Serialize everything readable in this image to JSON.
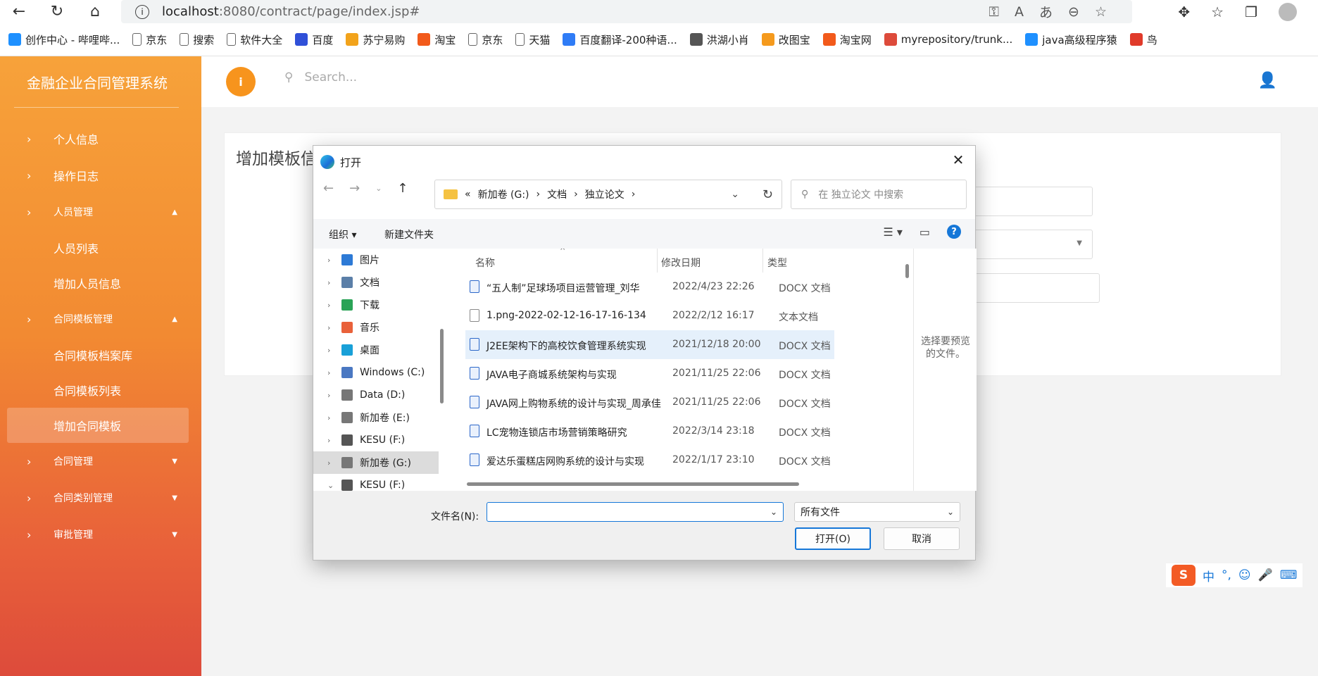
{
  "browser": {
    "url_host": "localhost",
    "url_rest": ":8080/contract/page/index.jsp#",
    "bookmarks": [
      {
        "label": "创作中心 - 哔哩哔...",
        "icon": "bilibili-icon",
        "color": "#1e90ff"
      },
      {
        "label": "京东",
        "icon": "page-icon",
        "color": "#666666"
      },
      {
        "label": "搜索",
        "icon": "page-icon",
        "color": "#666666"
      },
      {
        "label": "软件大全",
        "icon": "page-icon",
        "color": "#666666"
      },
      {
        "label": "百度",
        "icon": "baidu-icon",
        "color": "#3050d8"
      },
      {
        "label": "苏宁易购",
        "icon": "suning-icon",
        "color": "#f2a31b"
      },
      {
        "label": "淘宝",
        "icon": "taobao-icon",
        "color": "#f25a1b"
      },
      {
        "label": "京东",
        "icon": "page-icon",
        "color": "#666666"
      },
      {
        "label": "天猫",
        "icon": "page-icon",
        "color": "#666666"
      },
      {
        "label": "百度翻译-200种语...",
        "icon": "translate-icon",
        "color": "#2f7cf6"
      },
      {
        "label": "洪湖小肖",
        "icon": "bird-icon",
        "color": "#555555"
      },
      {
        "label": "改图宝",
        "icon": "gaitubao-icon",
        "color": "#f59a1d"
      },
      {
        "label": "淘宝网",
        "icon": "taobao-icon",
        "color": "#f25a1b"
      },
      {
        "label": "myrepository/trunk...",
        "icon": "chrome-icon",
        "color": "#dd4b3b"
      },
      {
        "label": "java高级程序猿",
        "icon": "bilibili-icon",
        "color": "#1e90ff"
      },
      {
        "label": "鸟",
        "icon": "bird-red-icon",
        "color": "#e03a2a"
      }
    ]
  },
  "app": {
    "brand": "金融企业合同管理系统",
    "search_placeholder": "Search...",
    "menu": [
      {
        "label": "个人信息",
        "type": "item"
      },
      {
        "label": "操作日志",
        "type": "item"
      },
      {
        "label": "人员管理",
        "type": "group",
        "caret": "▲"
      },
      {
        "label": "人员列表",
        "type": "sub"
      },
      {
        "label": "增加人员信息",
        "type": "sub"
      },
      {
        "label": "合同模板管理",
        "type": "group",
        "caret": "▲"
      },
      {
        "label": "合同模板档案库",
        "type": "sub"
      },
      {
        "label": "合同模板列表",
        "type": "sub"
      },
      {
        "label": "增加合同模板",
        "type": "sub-active"
      },
      {
        "label": "合同管理",
        "type": "group",
        "caret": "▼"
      },
      {
        "label": "合同类别管理",
        "type": "group",
        "caret": "▼"
      },
      {
        "label": "审批管理",
        "type": "group",
        "caret": "▼"
      }
    ],
    "page_title": "增加模板信"
  },
  "dialog": {
    "title": "打开",
    "path": [
      "«",
      "新加卷 (G:)",
      "文档",
      "独立论文"
    ],
    "search_placeholder": "在 独立论文 中搜索",
    "toolbar": {
      "organize": "组织 ▾",
      "new_folder": "新建文件夹"
    },
    "tree": [
      {
        "label": "图片",
        "color": "#2d7ad6"
      },
      {
        "label": "文档",
        "color": "#5b7fa8"
      },
      {
        "label": "下载",
        "color": "#2aa356"
      },
      {
        "label": "音乐",
        "color": "#e9613a"
      },
      {
        "label": "桌面",
        "color": "#19a0d8"
      },
      {
        "label": "Windows (C:)",
        "color": "#4a78c2"
      },
      {
        "label": "Data (D:)",
        "color": "#777777"
      },
      {
        "label": "新加卷 (E:)",
        "color": "#777777"
      },
      {
        "label": "KESU  (F:)",
        "color": "#555555"
      },
      {
        "label": "新加卷 (G:)",
        "color": "#777777",
        "selected": true
      },
      {
        "label": "KESU  (F:)",
        "color": "#555555",
        "expanded": true
      }
    ],
    "columns": {
      "name": "名称",
      "date": "修改日期",
      "type": "类型"
    },
    "files": [
      {
        "name": "“五人制”足球场项目运营管理_刘华",
        "date": "2022/4/23 22:26",
        "type": "DOCX 文档",
        "kind": "doc"
      },
      {
        "name": "1.png-2022-02-12-16-17-16-134",
        "date": "2022/2/12 16:17",
        "type": "文本文档",
        "kind": "txt"
      },
      {
        "name": "J2EE架构下的高校饮食管理系统实现",
        "date": "2021/12/18 20:00",
        "type": "DOCX 文档",
        "kind": "doc",
        "highlight": true
      },
      {
        "name": "JAVA电子商城系统架构与实现",
        "date": "2021/11/25 22:06",
        "type": "DOCX 文档",
        "kind": "doc"
      },
      {
        "name": "JAVA网上购物系统的设计与实现_周承佳",
        "date": "2021/11/25 22:06",
        "type": "DOCX 文档",
        "kind": "doc"
      },
      {
        "name": "LC宠物连锁店市场营销策略研究",
        "date": "2022/3/14 23:18",
        "type": "DOCX 文档",
        "kind": "doc"
      },
      {
        "name": "爱达乐蛋糕店网购系统的设计与实现",
        "date": "2022/1/17 23:10",
        "type": "DOCX 文档",
        "kind": "doc"
      }
    ],
    "preview_text": "选择要预览的文件。",
    "filename_label": "文件名(N):",
    "filename_value": "",
    "filetype": "所有文件",
    "open_label": "打开(O)",
    "cancel_label": "取消"
  },
  "ime": {
    "logo": "S",
    "mode": "中"
  }
}
